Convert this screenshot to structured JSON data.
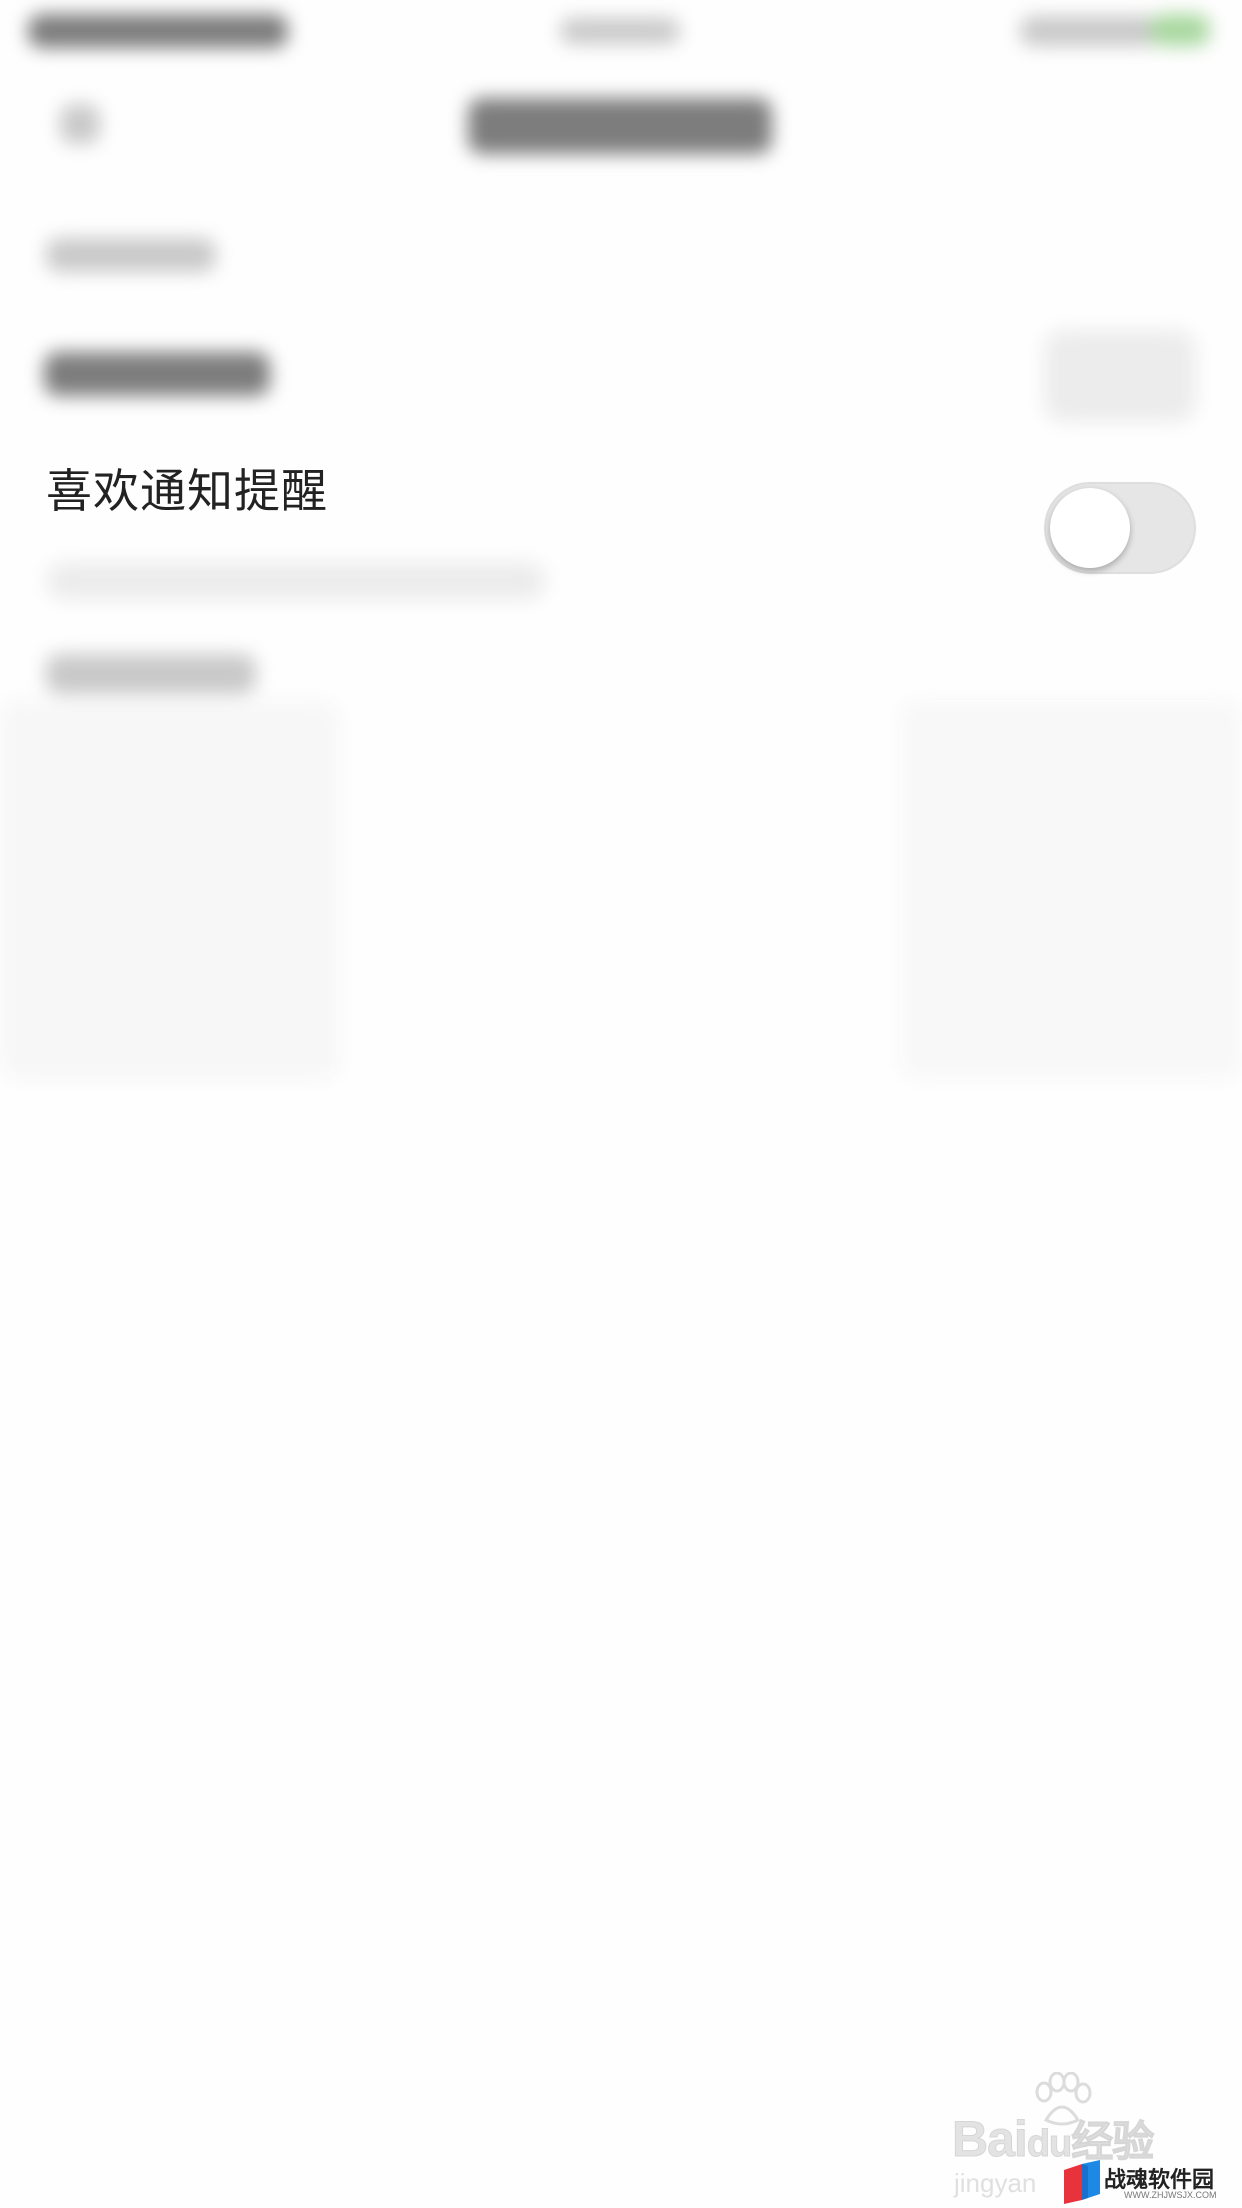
{
  "notification_settings": {
    "like_reminder_label": "喜欢通知提醒",
    "like_reminder_enabled": false
  },
  "watermark": {
    "baidu": "Bai",
    "du_suffix": "du",
    "jingyan_cn": "经验",
    "jingyan_pinyin": "jingyan"
  },
  "site_badge": {
    "name": "战魂软件园",
    "url": "WWW.ZHJWSJX.COM"
  },
  "colors": {
    "toggle_off": "#e6e6e6",
    "label_text": "#222222"
  }
}
